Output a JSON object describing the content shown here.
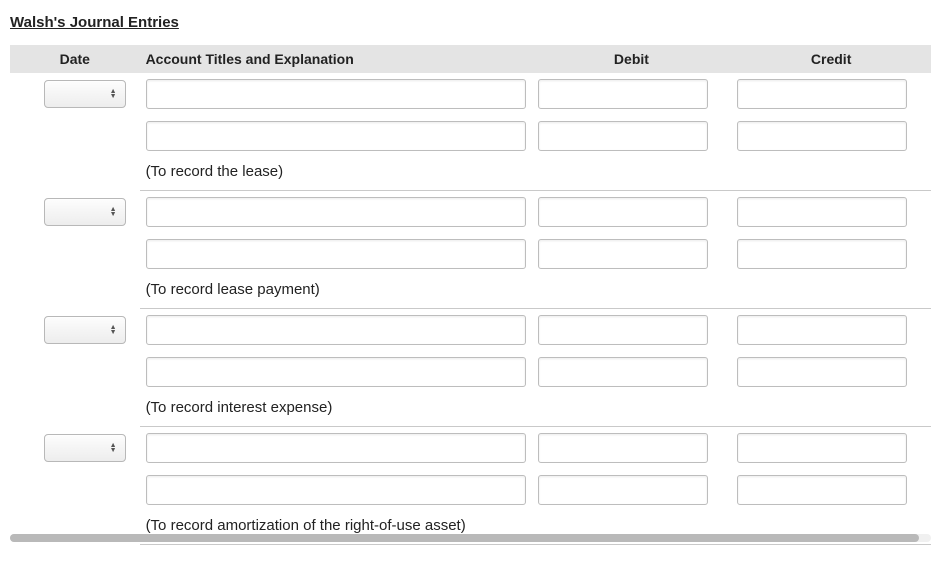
{
  "title": "Walsh's Journal Entries",
  "headers": {
    "date": "Date",
    "explanation": "Account Titles and Explanation",
    "debit": "Debit",
    "credit": "Credit"
  },
  "entries": [
    {
      "date": "",
      "lines": [
        {
          "account": "",
          "debit": "",
          "credit": ""
        },
        {
          "account": "",
          "debit": "",
          "credit": ""
        }
      ],
      "note": "(To record the lease)"
    },
    {
      "date": "",
      "lines": [
        {
          "account": "",
          "debit": "",
          "credit": ""
        },
        {
          "account": "",
          "debit": "",
          "credit": ""
        }
      ],
      "note": "(To record lease payment)"
    },
    {
      "date": "",
      "lines": [
        {
          "account": "",
          "debit": "",
          "credit": ""
        },
        {
          "account": "",
          "debit": "",
          "credit": ""
        }
      ],
      "note": "(To record interest expense)"
    },
    {
      "date": "",
      "lines": [
        {
          "account": "",
          "debit": "",
          "credit": ""
        },
        {
          "account": "",
          "debit": "",
          "credit": ""
        }
      ],
      "note": "(To record amortization of the right-of-use asset)"
    }
  ]
}
